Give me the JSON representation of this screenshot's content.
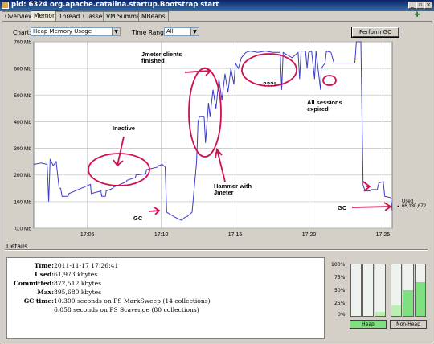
{
  "window": {
    "title": "pid: 6324 org.apache.catalina.startup.Bootstrap start"
  },
  "tabs": [
    "Overview",
    "Memory",
    "Threads",
    "Classes",
    "VM Summary",
    "MBeans"
  ],
  "active_tab": "Memory",
  "controls": {
    "chart_label": "Chart:",
    "chart_value": "Heap Memory Usage",
    "range_label": "Time Range:",
    "range_value": "All",
    "gc_button": "Perform GC"
  },
  "chart_data": {
    "type": "line",
    "y_ticks": [
      "0.0 Mb",
      "100 Mb",
      "200 Mb",
      "300 Mb",
      "400 Mb",
      "500 Mb",
      "600 Mb",
      "700 Mb"
    ],
    "x_ticks": [
      "17:05",
      "17:10",
      "17:15",
      "17:20",
      "17:25"
    ],
    "ylim": [
      0,
      700
    ],
    "grid": true,
    "series": [
      {
        "color": "#3c3cc8",
        "points": [
          [
            0.0,
            240
          ],
          [
            0.5,
            245
          ],
          [
            0.9,
            240
          ],
          [
            1.0,
            100
          ],
          [
            1.1,
            260
          ],
          [
            1.3,
            235
          ],
          [
            1.5,
            250
          ],
          [
            1.7,
            150
          ],
          [
            1.8,
            150
          ],
          [
            1.9,
            120
          ],
          [
            2.3,
            120
          ],
          [
            2.35,
            130
          ],
          [
            3.8,
            165
          ],
          [
            3.85,
            130
          ],
          [
            4.5,
            140
          ],
          [
            4.55,
            120
          ],
          [
            4.8,
            120
          ],
          [
            4.85,
            140
          ],
          [
            5.3,
            150
          ],
          [
            5.35,
            155
          ],
          [
            5.6,
            160
          ],
          [
            6.2,
            175
          ],
          [
            6.25,
            180
          ],
          [
            6.8,
            190
          ],
          [
            6.85,
            200
          ],
          [
            7.5,
            205
          ],
          [
            7.55,
            220
          ],
          [
            8.3,
            230
          ],
          [
            8.35,
            235
          ],
          [
            8.6,
            240
          ],
          [
            8.8,
            230
          ],
          [
            8.9,
            60
          ],
          [
            9.5,
            40
          ],
          [
            9.9,
            30
          ],
          [
            10.1,
            40
          ],
          [
            10.3,
            45
          ],
          [
            10.6,
            60
          ],
          [
            10.9,
            250
          ],
          [
            11.0,
            400
          ],
          [
            11.1,
            420
          ],
          [
            11.4,
            420
          ],
          [
            11.5,
            320
          ],
          [
            11.7,
            470
          ],
          [
            11.8,
            420
          ],
          [
            12.0,
            520
          ],
          [
            12.2,
            450
          ],
          [
            12.4,
            560
          ],
          [
            12.6,
            480
          ],
          [
            12.8,
            580
          ],
          [
            13.0,
            510
          ],
          [
            13.2,
            600
          ],
          [
            13.4,
            540
          ],
          [
            13.5,
            620
          ],
          [
            13.7,
            600
          ],
          [
            13.9,
            640
          ],
          [
            14.2,
            660
          ],
          [
            14.5,
            665
          ],
          [
            15.0,
            660
          ],
          [
            15.5,
            665
          ],
          [
            16.0,
            660
          ],
          [
            16.5,
            660
          ],
          [
            16.6,
            520
          ],
          [
            16.7,
            660
          ],
          [
            17.3,
            640
          ],
          [
            17.7,
            660
          ],
          [
            17.8,
            560
          ],
          [
            17.9,
            665
          ],
          [
            18.2,
            665
          ],
          [
            18.3,
            600
          ],
          [
            18.4,
            660
          ],
          [
            18.6,
            665
          ],
          [
            18.8,
            560
          ],
          [
            18.9,
            665
          ],
          [
            19.2,
            520
          ],
          [
            19.25,
            600
          ],
          [
            19.5,
            620
          ],
          [
            19.6,
            665
          ],
          [
            19.9,
            660
          ],
          [
            20.1,
            620
          ],
          [
            20.3,
            620
          ],
          [
            21.5,
            620
          ],
          [
            21.6,
            700
          ],
          [
            21.9,
            700
          ],
          [
            22.0,
            350
          ],
          [
            22.05,
            160
          ],
          [
            22.2,
            140
          ],
          [
            22.5,
            140
          ],
          [
            22.6,
            145
          ],
          [
            23.0,
            145
          ],
          [
            23.1,
            170
          ],
          [
            23.4,
            175
          ],
          [
            23.5,
            120
          ],
          [
            23.9,
            115
          ],
          [
            24.0,
            66
          ]
        ]
      }
    ],
    "annotations": [
      "Inactive",
      "GC",
      "Jmeter clients finished",
      "Hammer with Jmeter",
      "???!",
      "All sessions expired",
      "GC"
    ],
    "readout_label": "Used",
    "readout_value": "66,130,672"
  },
  "details": {
    "title": "Details",
    "rows": [
      {
        "key": "Time:",
        "value": "2011-11-17 17:26:41"
      },
      {
        "key": "Used:",
        "value": "61,973 kbytes"
      },
      {
        "key": "Committed:",
        "value": "872,512 kbytes"
      },
      {
        "key": "Max:",
        "value": "895,680 kbytes"
      },
      {
        "key": "GC time:",
        "value": "10.300 seconds on PS MarkSweep (14 collections)"
      },
      {
        "key": "",
        "value": "6.058 seconds on PS Scavenge (80 collections)"
      }
    ]
  },
  "gauges": {
    "ticks": [
      "100%",
      "75%",
      "50%",
      "25%",
      "0%"
    ],
    "heap_label": "Heap",
    "nonheap_label": "Non-Heap",
    "heap_levels": [
      0.0,
      0.0,
      0.08
    ],
    "nonheap_levels": [
      0.2,
      0.5,
      0.65
    ],
    "highlight": "#7fe07f"
  }
}
